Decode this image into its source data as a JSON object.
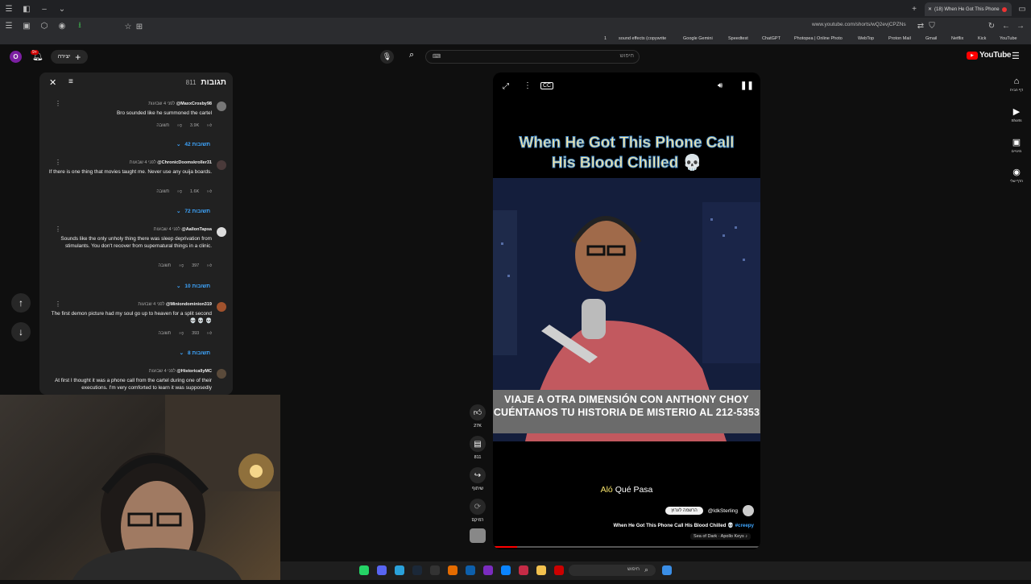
{
  "browser": {
    "active_tab_title": "(18) When He Got This Phone",
    "url": "www.youtube.com/shorts/wQ2evjCPZNs",
    "bookmarks": [
      "sound effects (copywrite",
      "Google Gemini",
      "Speedtest",
      "ChatGPT",
      "Photopea | Online Photo",
      "WebTop",
      "Proton Mail",
      "Gmail",
      "Netflix",
      "Kick",
      "YouTube"
    ],
    "bookmarks_count_prefix": "1"
  },
  "header": {
    "logo_text": "YouTube",
    "search_placeholder": "חיפוש",
    "create_label": "יצירה",
    "notif_count": "9+",
    "avatar_letter": "O"
  },
  "comments": {
    "title": "תגובות",
    "count": "811",
    "items": [
      {
        "author": "@MaxxCrosby98",
        "time": "לפני 4 שבועות",
        "text": "Bro sounded like he summoned the cartel",
        "likes": "3.9K",
        "reply": "תשובה",
        "replies": "42 תשובות"
      },
      {
        "author": "@ChronicDoomskroller31",
        "time": "לפני 4 שבועות",
        "text": "If there is one thing that movies taught me. Never use any ouija boards.",
        "likes": "1.6K",
        "reply": "תשובה",
        "replies": "72 תשובות"
      },
      {
        "author": "@AallonTapsa",
        "time": "לפני 4 שבועות",
        "text": "Sounds like the only unholy thing there was sleep deprivation from stimulants. You don't recover from supernatural things in a clinic.",
        "likes": "397",
        "reply": "תשובה",
        "replies": "10 תשובות"
      },
      {
        "author": "@Miniondominion319",
        "time": "לפני 4 שבועות",
        "text": "The first demon picture had my soul go up to heaven for a split second 💀 💀 💀",
        "likes": "393",
        "reply": "תשובה",
        "replies": "8 תשובות"
      },
      {
        "author": "@HistoricallyMC",
        "time": "לפני 4 שבועות",
        "text": "At first I thought it was a phone call from the cartel during one of their executions. I'm very comforted to learn it was supposedly",
        "likes": "",
        "reply": "",
        "replies": ""
      }
    ]
  },
  "video": {
    "title_line1": "When He Got This Phone Call",
    "title_line2": "His Blood Chilled 💀",
    "banner_line1": "VIAJE A OTRA DIMENSIÓN CON ANTHONY CHOY",
    "banner_line2": "CUÉNTANOS TU HISTORIA DE MISTERIO AL 212-5353",
    "subtitle_highlight": "Aló",
    "subtitle_rest": " Qué Pasa",
    "channel": "@IdkSterling",
    "subscribe": "הרשמה לערוץ",
    "description": "When He Got This Phone Call His Blood Chilled 💀 ",
    "hashtag": "#creepy",
    "music": "Sea of Dark · Apollo Keys ♪",
    "progress": 0.09
  },
  "actions": {
    "likes": "27K",
    "comments": "811",
    "share": "שיתוף",
    "remix": "רמיקס"
  },
  "nav": {
    "home": "דף הבית",
    "shorts": "Shorts",
    "subs": "מינויים",
    "you": "הדף שלי"
  },
  "taskbar": {
    "search": "חיפוש"
  },
  "colors": {
    "brand": "#ff0000",
    "link": "#3ea6ff",
    "panel": "#212121"
  }
}
